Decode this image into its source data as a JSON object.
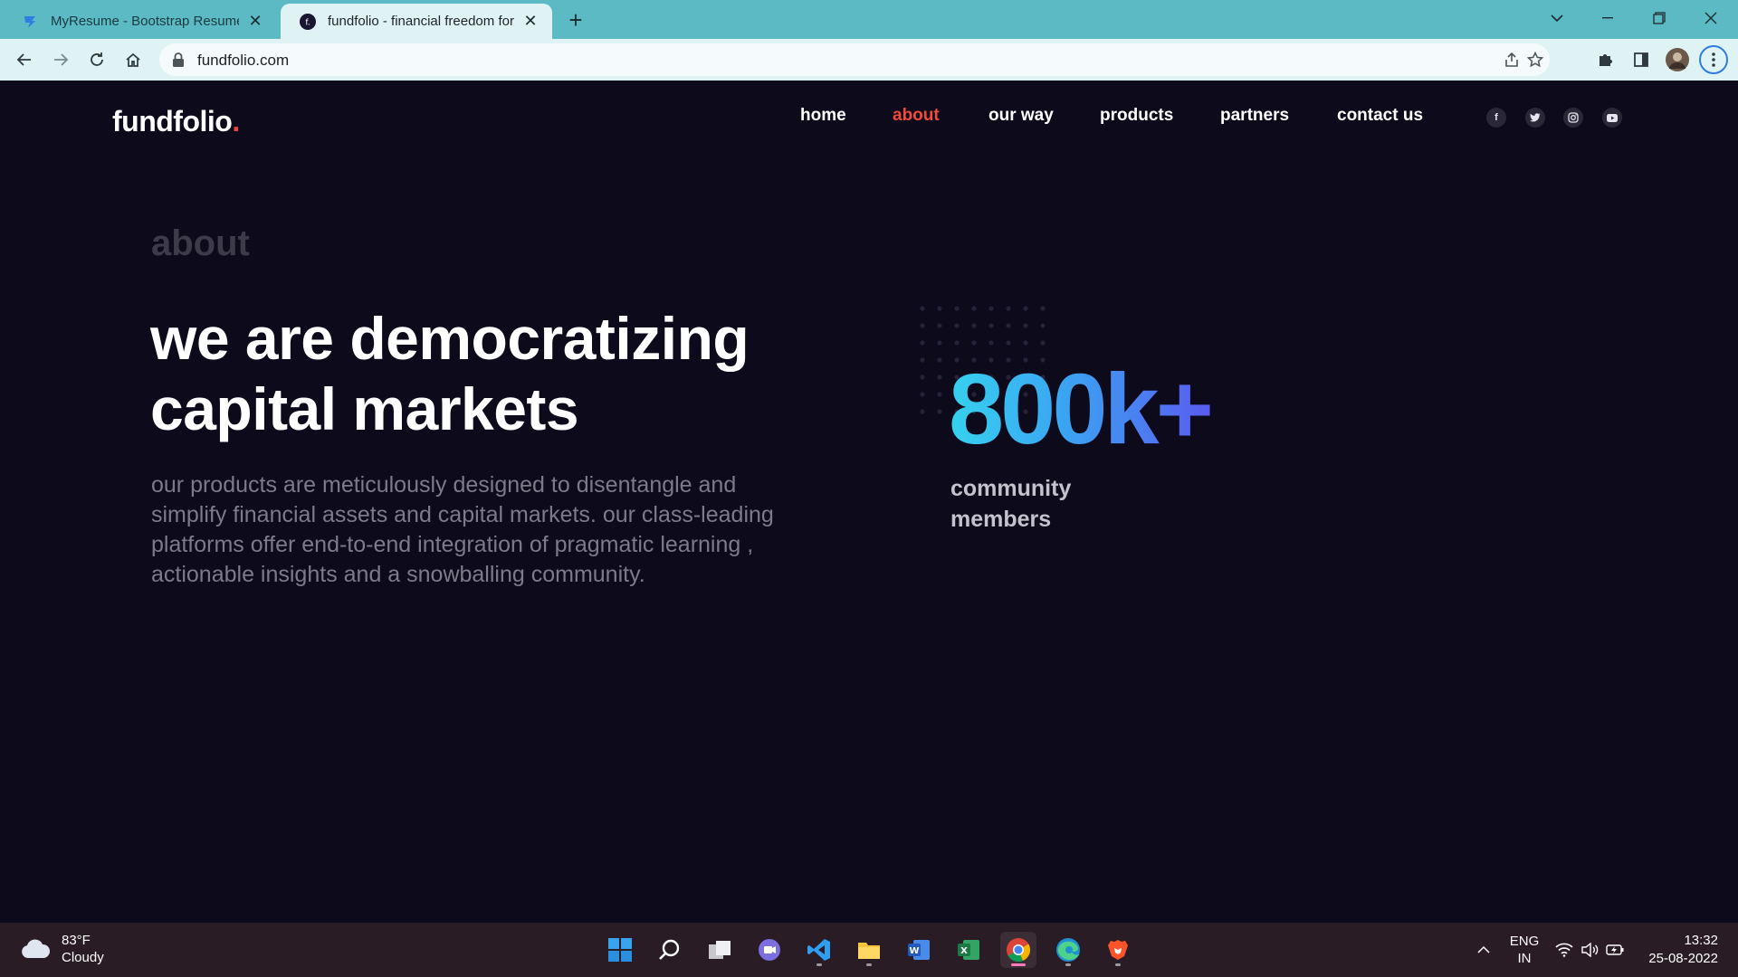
{
  "browser": {
    "tabs": [
      {
        "title": "MyResume - Bootstrap Resume a",
        "active": false
      },
      {
        "title": "fundfolio - financial freedom for a",
        "active": true
      }
    ],
    "url": "fundfolio.com"
  },
  "site": {
    "logo_text": "fundfolio",
    "logo_dot": ".",
    "nav": [
      "home",
      "about",
      "our way",
      "products",
      "partners",
      "contact us"
    ],
    "active_nav": "about",
    "social": [
      "facebook",
      "twitter",
      "instagram",
      "youtube"
    ]
  },
  "about": {
    "section_label": "about",
    "headline_line1": "we are democratizing",
    "headline_line2": "capital markets",
    "lead": "our products are meticulously designed to disentangle and simplify financial assets and capital markets. our class-leading platforms offer end-to-end integration of pragmatic learning , actionable insights and a snowballing community.",
    "stat_value": "800k+",
    "stat_label_line1": "community",
    "stat_label_line2": "members"
  },
  "taskbar": {
    "weather_temp": "83°F",
    "weather_desc": "Cloudy",
    "lang_line1": "ENG",
    "lang_line2": "IN",
    "time": "13:32",
    "date": "25-08-2022"
  },
  "colors": {
    "page_bg": "#0d0a1c",
    "accent_red": "#f04a3a",
    "stat_gradient_start": "#36d2ef",
    "stat_gradient_end": "#5a5cf0",
    "chrome_teal": "#5cbac4"
  }
}
